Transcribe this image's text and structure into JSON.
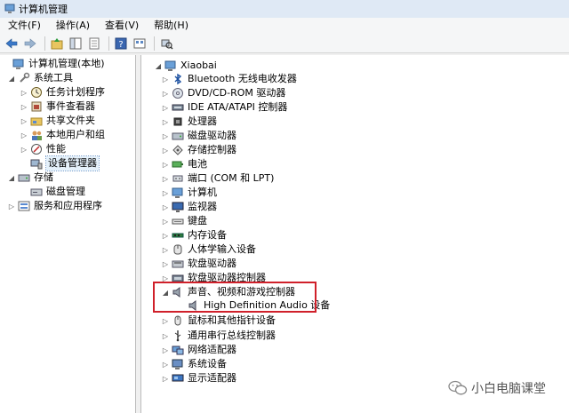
{
  "window": {
    "title": "计算机管理"
  },
  "menu": [
    {
      "label": "文件(F)"
    },
    {
      "label": "操作(A)"
    },
    {
      "label": "查看(V)"
    },
    {
      "label": "帮助(H)"
    }
  ],
  "toolbar": {
    "buttons": [
      {
        "icon": "back-arrow-icon"
      },
      {
        "icon": "forward-arrow-icon"
      },
      {
        "icon": "up-folder-icon"
      },
      {
        "icon": "show-hide-tree-icon"
      },
      {
        "icon": "properties-icon"
      },
      {
        "icon": "help-icon"
      },
      {
        "icon": "view-icon"
      },
      {
        "icon": "scan-hardware-icon"
      }
    ]
  },
  "left_tree": [
    {
      "label": "计算机管理(本地)",
      "arrow": "",
      "icon": "computer-mgmt-icon"
    },
    {
      "label": "系统工具",
      "arrow": "◢",
      "icon": "tools-icon"
    },
    {
      "label": "任务计划程序",
      "arrow": "▷",
      "icon": "clock-icon"
    },
    {
      "label": "事件查看器",
      "arrow": "▷",
      "icon": "event-viewer-icon"
    },
    {
      "label": "共享文件夹",
      "arrow": "▷",
      "icon": "shared-folder-icon"
    },
    {
      "label": "本地用户和组",
      "arrow": "▷",
      "icon": "users-icon"
    },
    {
      "label": "性能",
      "arrow": "▷",
      "icon": "performance-icon"
    },
    {
      "label": "设备管理器",
      "arrow": "",
      "icon": "device-manager-icon",
      "selected": true
    },
    {
      "label": "存储",
      "arrow": "◢",
      "icon": "storage-icon"
    },
    {
      "label": "磁盘管理",
      "arrow": "",
      "icon": "disk-mgmt-icon"
    },
    {
      "label": "服务和应用程序",
      "arrow": "▷",
      "icon": "services-icon"
    }
  ],
  "device_tree": [
    {
      "label": "Xiaobai",
      "arrow": "◢",
      "icon": "computer-icon"
    },
    {
      "label": "Bluetooth 无线电收发器",
      "arrow": "▷",
      "icon": "bluetooth-icon"
    },
    {
      "label": "DVD/CD-ROM 驱动器",
      "arrow": "▷",
      "icon": "dvd-icon"
    },
    {
      "label": "IDE ATA/ATAPI 控制器",
      "arrow": "▷",
      "icon": "ide-icon"
    },
    {
      "label": "处理器",
      "arrow": "▷",
      "icon": "processor-icon"
    },
    {
      "label": "磁盘驱动器",
      "arrow": "▷",
      "icon": "disk-drive-icon"
    },
    {
      "label": "存储控制器",
      "arrow": "▷",
      "icon": "storage-controller-icon"
    },
    {
      "label": "电池",
      "arrow": "▷",
      "icon": "battery-icon"
    },
    {
      "label": "端口 (COM 和 LPT)",
      "arrow": "▷",
      "icon": "port-icon"
    },
    {
      "label": "计算机",
      "arrow": "▷",
      "icon": "computer-icon"
    },
    {
      "label": "监视器",
      "arrow": "▷",
      "icon": "monitor-icon"
    },
    {
      "label": "键盘",
      "arrow": "▷",
      "icon": "keyboard-icon"
    },
    {
      "label": "内存设备",
      "arrow": "▷",
      "icon": "memory-icon"
    },
    {
      "label": "人体学输入设备",
      "arrow": "▷",
      "icon": "hid-icon"
    },
    {
      "label": "软盘驱动器",
      "arrow": "▷",
      "icon": "floppy-drive-icon"
    },
    {
      "label": "软盘驱动器控制器",
      "arrow": "▷",
      "icon": "floppy-controller-icon"
    },
    {
      "label": "声音、视频和游戏控制器",
      "arrow": "◢",
      "icon": "speaker-icon",
      "highlight": true
    },
    {
      "label": "High Definition Audio 设备",
      "arrow": "",
      "icon": "speaker-icon",
      "child": true
    },
    {
      "label": "鼠标和其他指针设备",
      "arrow": "▷",
      "icon": "mouse-icon"
    },
    {
      "label": "通用串行总线控制器",
      "arrow": "▷",
      "icon": "usb-icon"
    },
    {
      "label": "网络适配器",
      "arrow": "▷",
      "icon": "network-icon"
    },
    {
      "label": "系统设备",
      "arrow": "▷",
      "icon": "system-device-icon"
    },
    {
      "label": "显示适配器",
      "arrow": "▷",
      "icon": "display-adapter-icon"
    }
  ],
  "watermark": {
    "text": "小白电脑课堂",
    "icon": "wechat-icon"
  },
  "colors": {
    "highlight_box": "#d0202a",
    "title_bg": "#dfe9f5"
  }
}
